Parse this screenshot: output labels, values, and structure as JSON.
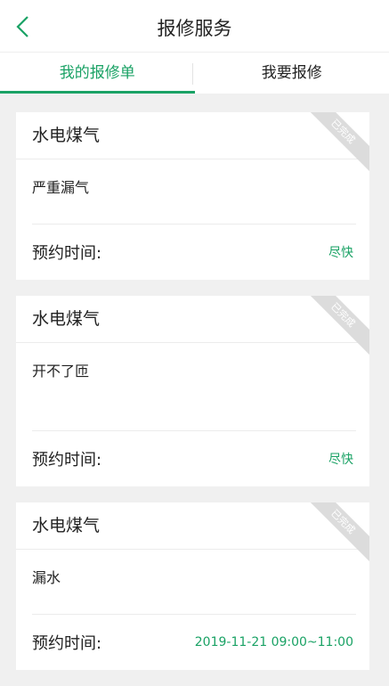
{
  "header": {
    "title": "报修服务",
    "back_icon": "chevron-left-icon",
    "accent": "#1aa265"
  },
  "tabs": [
    {
      "label": "我的报修单",
      "active": true
    },
    {
      "label": "我要报修",
      "active": false
    }
  ],
  "orders": [
    {
      "category": "水电煤气",
      "description": "严重漏气",
      "time_label": "预约时间:",
      "time_value": "尽快",
      "status": "已完成"
    },
    {
      "category": "水电煤气",
      "description": "开不了匝",
      "time_label": "预约时间:",
      "time_value": "尽快",
      "status": "已完成"
    },
    {
      "category": "水电煤气",
      "description": "漏水",
      "time_label": "预约时间:",
      "time_value": "2019-11-21 09:00~11:00",
      "status": "已完成"
    }
  ]
}
